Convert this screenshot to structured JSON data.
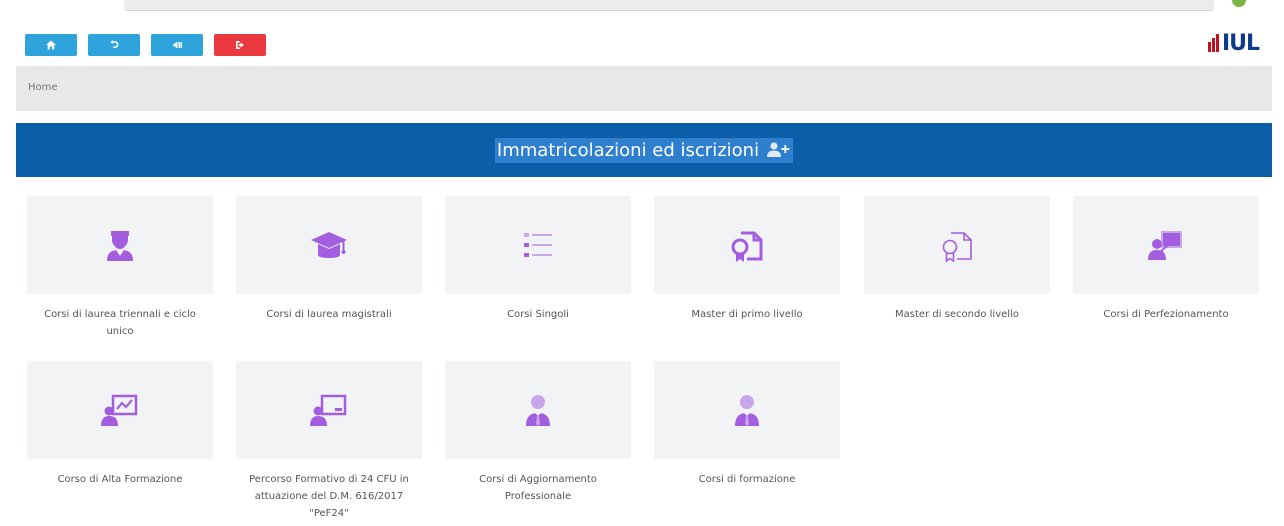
{
  "app": {
    "logo_text": "IUL",
    "colors": {
      "primary_button": "#2ea3dc",
      "exit_button": "#ea3a3f",
      "banner": "#0a5fa8",
      "icon_purple": "#a35ee0",
      "icon_light_purple": "#c9a6ea",
      "logo_red": "#c1121f",
      "logo_blue": "#0d3a8a"
    }
  },
  "toolbar": {
    "buttons": [
      {
        "icon": "home-icon"
      },
      {
        "icon": "undo-icon"
      },
      {
        "icon": "back-icon"
      },
      {
        "icon": "logout-icon"
      }
    ]
  },
  "breadcrumb": {
    "home": "Home"
  },
  "banner": {
    "title": "Immatricolazioni ed iscrizioni",
    "icon": "user-add-icon"
  },
  "tiles": [
    {
      "label": "Corsi di laurea triennali e ciclo unico",
      "icon": "graduate-student-icon"
    },
    {
      "label": "Corsi di laurea magistrali",
      "icon": "graduation-cap-icon"
    },
    {
      "label": "Corsi Singoli",
      "icon": "list-icon"
    },
    {
      "label": "Master di primo livello",
      "icon": "certificate-icon"
    },
    {
      "label": "Master di secondo livello",
      "icon": "certificate-outline-icon"
    },
    {
      "label": "Corsi di Perfezionamento",
      "icon": "teacher-board-icon"
    },
    {
      "label": "Corso di Alta Formazione",
      "icon": "presentation-chart-icon"
    },
    {
      "label": "Percorso Formativo di 24 CFU in attuazione del D.M. 616/2017 \"PeF24\"",
      "icon": "teacher-screen-icon"
    },
    {
      "label": "Corsi di Aggiornamento Professionale",
      "icon": "businessman-icon"
    },
    {
      "label": "Corsi di formazione",
      "icon": "businessman-icon"
    }
  ]
}
